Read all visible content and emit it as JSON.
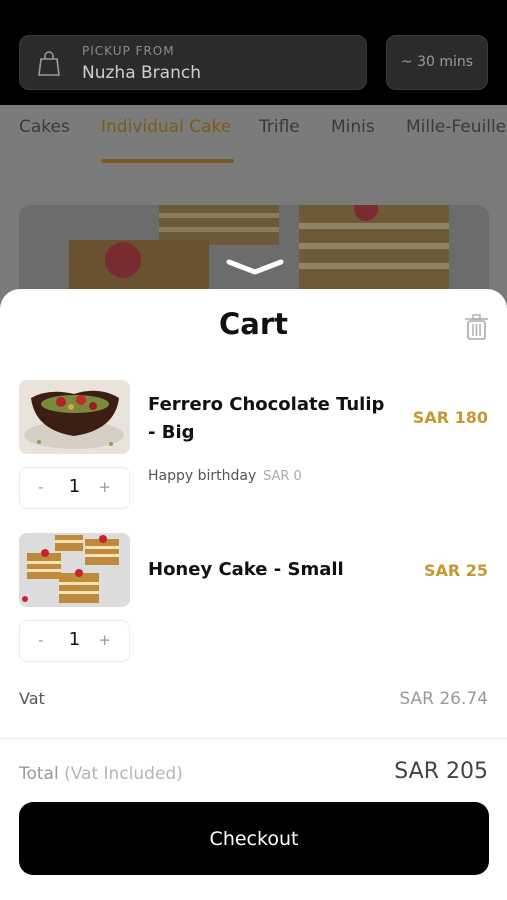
{
  "header": {
    "pickup_label": "PICKUP FROM",
    "branch": "Nuzha Branch",
    "eta": "~ 30 mins"
  },
  "tabs": [
    {
      "label": "Cakes"
    },
    {
      "label": "Individual Cake",
      "active": true
    },
    {
      "label": "Trifle"
    },
    {
      "label": "Minis"
    },
    {
      "label": "Mille-Feuille"
    }
  ],
  "cart": {
    "title": "Cart",
    "items": [
      {
        "name": "Ferrero Chocolate Tulip - Big",
        "price": "SAR 180",
        "quantity": "1",
        "note": "Happy birthday",
        "note_price": "SAR 0"
      },
      {
        "name": "Honey Cake - Small",
        "price": "SAR 25",
        "quantity": "1"
      }
    ],
    "vat_label": "Vat",
    "vat_value": "SAR 26.74",
    "total_label": "Total",
    "total_note": "(Vat Included)",
    "total_value": "SAR 205",
    "checkout_label": "Checkout",
    "qty_minus": "-",
    "qty_plus": "+"
  },
  "colors": {
    "accent": "#c9962f",
    "button_bg": "#000000"
  }
}
